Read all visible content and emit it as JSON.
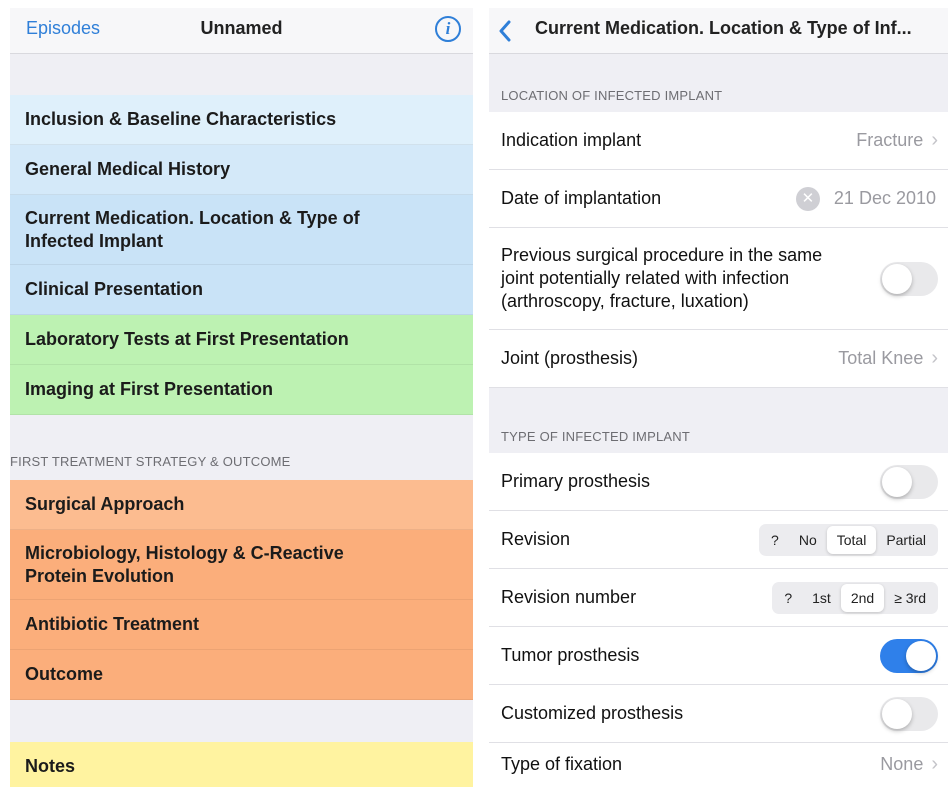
{
  "left": {
    "back_label": "Episodes",
    "title": "Unnamed",
    "info_glyph": "i",
    "items": [
      {
        "label": "Inclusion & Baseline Characteristics"
      },
      {
        "label": "General Medical History"
      },
      {
        "label": "Current Medication. Location & Type of Infected Implant"
      },
      {
        "label": "Clinical Presentation"
      },
      {
        "label": "Laboratory Tests at First Presentation"
      },
      {
        "label": "Imaging at First Presentation"
      }
    ],
    "section_header": "FIRST TREATMENT STRATEGY & OUTCOME",
    "items2": [
      {
        "label": "Surgical Approach"
      },
      {
        "label": "Microbiology, Histology & C-Reactive Protein Evolution"
      },
      {
        "label": "Antibiotic Treatment"
      },
      {
        "label": "Outcome"
      }
    ],
    "notes_label": "Notes"
  },
  "right": {
    "title": "Current Medication. Location & Type of Inf...",
    "group1_header": "LOCATION OF INFECTED IMPLANT",
    "indication_label": "Indication implant",
    "indication_value": "Fracture",
    "date_label": "Date of implantation",
    "date_value": "21 Dec 2010",
    "clear_glyph": "✕",
    "previous_label": "Previous surgical procedure in the same joint potentially related with infection (arthroscopy, fracture, luxation)",
    "previous_on": false,
    "joint_label": "Joint (prosthesis)",
    "joint_value": "Total Knee",
    "group2_header": "TYPE OF INFECTED IMPLANT",
    "primary_label": "Primary prosthesis",
    "primary_on": false,
    "revision_label": "Revision",
    "revision_options": [
      "?",
      "No",
      "Total",
      "Partial"
    ],
    "revision_selected": "Total",
    "revnum_label": "Revision number",
    "revnum_options": [
      "?",
      "1st",
      "2nd",
      "≥ 3rd"
    ],
    "revnum_selected": "2nd",
    "tumor_label": "Tumor prosthesis",
    "tumor_on": true,
    "custom_label": "Customized prosthesis",
    "custom_on": false,
    "fixation_label": "Type of fixation",
    "fixation_value": "None",
    "chevron": "›"
  },
  "colors": {
    "accent": "#2f7fd8",
    "toggle_on": "#2f80ea",
    "blue_section": "#d4e9f9",
    "green_section": "#bdf2b2",
    "orange_section": "#fbae7b",
    "yellow_section": "#fff3a0"
  }
}
